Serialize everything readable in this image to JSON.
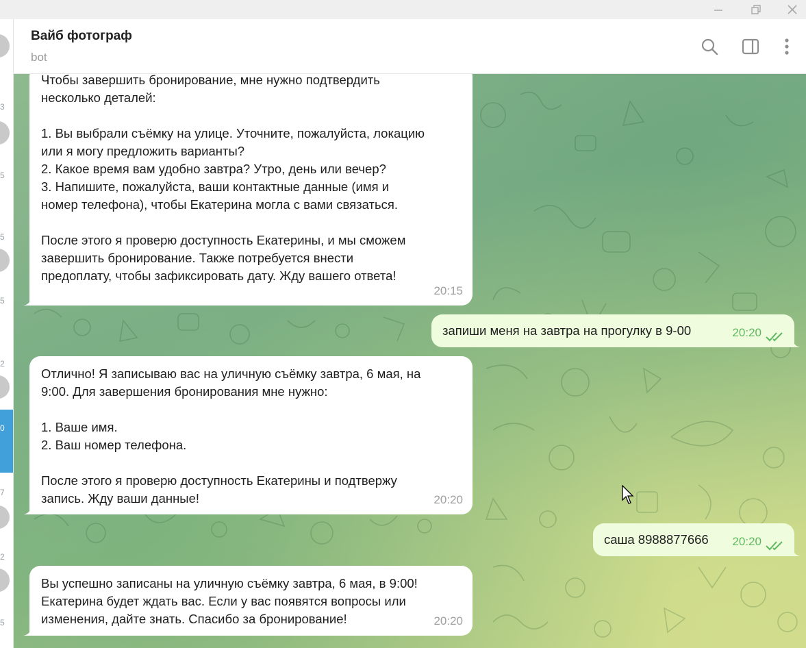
{
  "window": {
    "controls": {
      "minimize": "minimize-icon",
      "maximize": "restore-icon",
      "close": "close-icon"
    }
  },
  "chatlist": {
    "items": [
      {
        "time": "3",
        "active": false
      },
      {
        "time": "5",
        "active": false
      },
      {
        "time": "5",
        "active": false
      },
      {
        "time": "5",
        "active": false
      },
      {
        "time": "2",
        "active": false
      },
      {
        "time": "0",
        "active": true
      },
      {
        "time": "7",
        "active": false
      },
      {
        "time": "2",
        "active": false
      },
      {
        "time": "5",
        "active": false
      }
    ]
  },
  "header": {
    "title": "Вайб фотограф",
    "subtitle": "bot",
    "icons": [
      "search-icon",
      "sidebar-toggle-icon",
      "more-vertical-icon"
    ]
  },
  "colors": {
    "accent": "#419fd9",
    "incoming_bubble": "#ffffff",
    "outgoing_bubble": "#effdde",
    "outgoing_time": "#5fb85f"
  },
  "messages": [
    {
      "direction": "in",
      "text": "Чтобы завершить бронирование, мне нужно подтвердить\nнесколько деталей:\n\n1. Вы выбрали съёмку на улице. Уточните, пожалуйста, локацию\nили я могу предложить варианты?\n2. Какое время вам удобно завтра? Утро, день или вечер?\n3. Напишите, пожалуйста, ваши контактные данные (имя и\nномер телефона), чтобы Екатерина могла с вами связаться.\n\nПосле этого я проверю доступность Екатерины, и мы сможем\nзавершить бронирование. Также потребуется внести\nпредоплату, чтобы зафиксировать дату. Жду вашего ответа!",
      "time": "20:15"
    },
    {
      "direction": "out",
      "text": "запиши меня на завтра на прогулку в 9-00",
      "time": "20:20",
      "status": "read"
    },
    {
      "direction": "in",
      "text": "Отлично! Я записываю вас на уличную съёмку завтра, 6 мая, на\n9:00. Для завершения бронирования мне нужно:\n\n1. Ваше имя.\n2. Ваш номер телефона.\n\nПосле этого я проверю доступность Екатерины и подтвержу\nзапись. Жду ваши данные!",
      "time": "20:20"
    },
    {
      "direction": "out",
      "text": "саша 8988877666",
      "time": "20:20",
      "status": "read"
    },
    {
      "direction": "in",
      "text": "Вы успешно записаны на уличную съёмку завтра, 6 мая, в 9:00!\nЕкатерина будет ждать вас. Если у вас появятся вопросы или\nизменения, дайте знать. Спасибо за бронирование!",
      "time": "20:20"
    }
  ]
}
